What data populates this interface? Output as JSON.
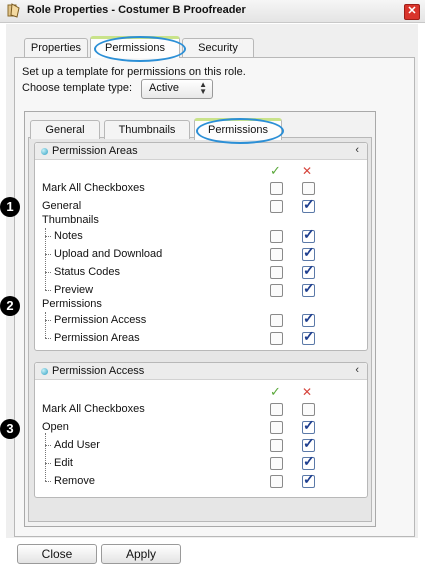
{
  "window": {
    "title": "Role Properties - Costumer B Proofreader",
    "close_icon": "close-icon"
  },
  "top_tabs": [
    {
      "label": "Properties",
      "active": false
    },
    {
      "label": "Permissions",
      "active": true
    },
    {
      "label": "Security",
      "active": false
    }
  ],
  "help_text": "Set up a template for permissions on this role.",
  "template": {
    "label": "Choose template type:",
    "value": "Active"
  },
  "inner_tabs": [
    {
      "label": "General",
      "active": false
    },
    {
      "label": "Thumbnails",
      "active": false
    },
    {
      "label": "Permissions",
      "active": true
    }
  ],
  "sections": [
    {
      "title": "Permission Areas",
      "collapse": "‹",
      "allow_icon": "✓",
      "deny_icon": "✕",
      "rows": [
        {
          "label": "Mark All Checkboxes",
          "allow": false,
          "deny": false
        },
        {
          "label": "General",
          "allow": false,
          "deny": true
        },
        {
          "label": "Thumbnails"
        },
        {
          "label": "Notes",
          "allow": false,
          "deny": true
        },
        {
          "label": "Upload and Download",
          "allow": false,
          "deny": true
        },
        {
          "label": "Status Codes",
          "allow": false,
          "deny": true
        },
        {
          "label": "Preview",
          "allow": false,
          "deny": true
        },
        {
          "label": "Permissions"
        },
        {
          "label": "Permission Access",
          "allow": false,
          "deny": true
        },
        {
          "label": "Permission Areas",
          "allow": false,
          "deny": true
        }
      ]
    },
    {
      "title": "Permission Access",
      "collapse": "‹",
      "allow_icon": "✓",
      "deny_icon": "✕",
      "rows": [
        {
          "label": "Mark All Checkboxes",
          "allow": false,
          "deny": false
        },
        {
          "label": "Open",
          "allow": false,
          "deny": true
        },
        {
          "label": "Add User",
          "allow": false,
          "deny": true
        },
        {
          "label": "Edit",
          "allow": false,
          "deny": true
        },
        {
          "label": "Remove",
          "allow": false,
          "deny": true
        }
      ]
    }
  ],
  "markers": [
    "1",
    "2",
    "3"
  ],
  "buttons": {
    "close": "Close",
    "apply": "Apply"
  }
}
